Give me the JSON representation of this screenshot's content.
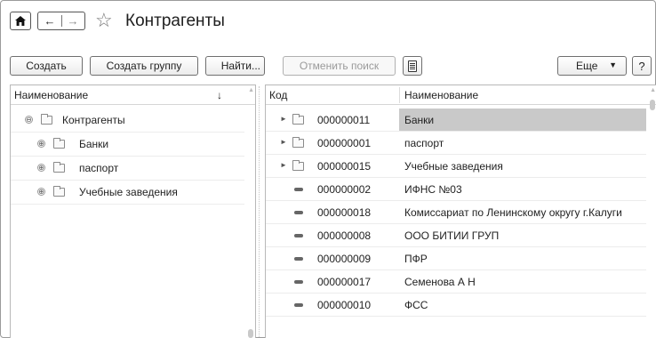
{
  "window": {
    "title": "Контрагенты"
  },
  "nav": {
    "home_icon": "home-icon",
    "back_icon": "arrow-left-icon",
    "forward_icon": "arrow-right-icon",
    "favorite_icon": "star-outline-icon"
  },
  "toolbar": {
    "create_label": "Создать",
    "create_group_label": "Создать группу",
    "find_label": "Найти...",
    "cancel_search_label": "Отменить поиск",
    "report_icon": "document-icon",
    "more_label": "Еще",
    "more_caret": "▼",
    "help_label": "?"
  },
  "left_panel": {
    "column_header": "Наименование",
    "sort_indicator": "↓",
    "tree": [
      {
        "label": "Контрагенты",
        "expander": "⊖",
        "level": 0
      },
      {
        "label": "Банки",
        "expander": "⊕",
        "level": 1
      },
      {
        "label": "паспорт",
        "expander": "⊕",
        "level": 1
      },
      {
        "label": "Учебные заведения",
        "expander": "⊕",
        "level": 1
      }
    ]
  },
  "right_panel": {
    "columns": [
      "Код",
      "Наименование"
    ],
    "rows": [
      {
        "code": "000000011",
        "name": "Банки",
        "type": "group",
        "selected": true
      },
      {
        "code": "000000001",
        "name": "паспорт",
        "type": "group",
        "selected": false
      },
      {
        "code": "000000015",
        "name": "Учебные заведения",
        "type": "group",
        "selected": false
      },
      {
        "code": "000000002",
        "name": "ИФНС №03",
        "type": "item",
        "selected": false
      },
      {
        "code": "000000018",
        "name": "Комиссариат по Ленинскому округу г.Калуги",
        "type": "item",
        "selected": false
      },
      {
        "code": "000000008",
        "name": "ООО БИТИИ ГРУП",
        "type": "item",
        "selected": false
      },
      {
        "code": "000000009",
        "name": "ПФР",
        "type": "item",
        "selected": false
      },
      {
        "code": "000000017",
        "name": "Семенова А Н",
        "type": "item",
        "selected": false
      },
      {
        "code": "000000010",
        "name": "ФСС",
        "type": "item",
        "selected": false
      }
    ]
  },
  "colors": {
    "selected_row": "#c9c9c9",
    "border": "#6f6f6f"
  }
}
